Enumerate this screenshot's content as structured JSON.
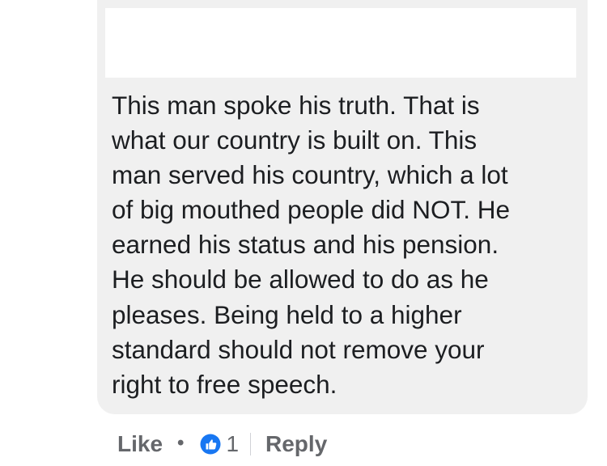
{
  "comment": {
    "text": "This man spoke his truth. That is\nwhat our country is built on. This\nman served his country, which a lot\nof big mouthed people did NOT. He\nearned his status and his pension.\nHe should be allowed to do as he\npleases. Being held to a higher\nstandard should not remove your\nright to free speech."
  },
  "actions": {
    "like_label": "Like",
    "separator": "•",
    "reaction_icon": "thumbs-up-icon",
    "reaction_count": "1",
    "reply_label": "Reply"
  },
  "colors": {
    "bubble": "#f0f0f0",
    "text": "#1c1e21",
    "action_text": "#65676b",
    "like_blue": "#1877f2"
  }
}
